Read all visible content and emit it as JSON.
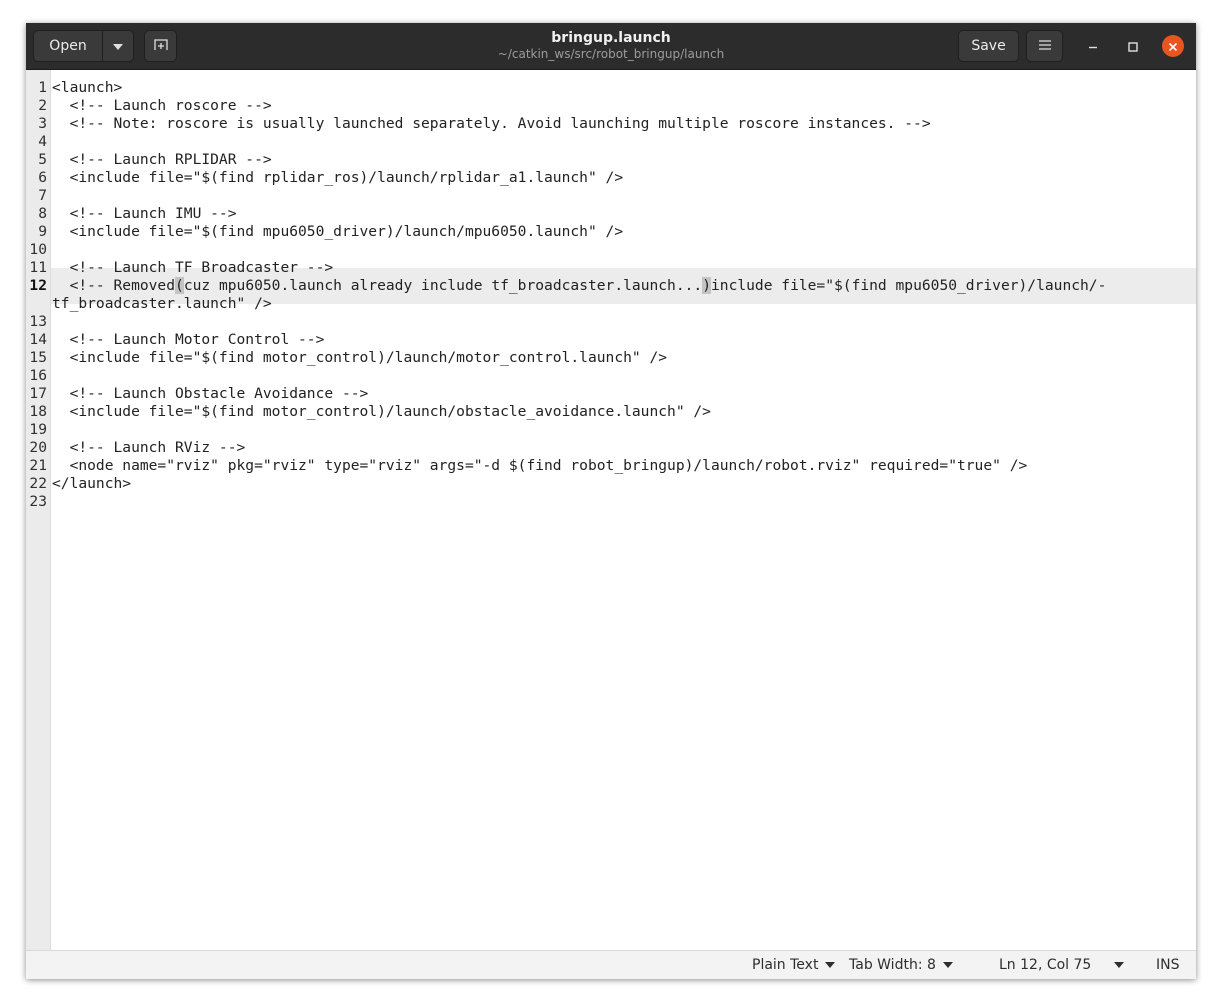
{
  "window": {
    "title": "bringup.launch",
    "subtitle": "~/catkin_ws/src/robot_bringup/launch"
  },
  "header": {
    "open_label": "Open",
    "save_label": "Save",
    "icons": {
      "open_dropdown": "chevron-down-icon",
      "new_tab": "new-tab-icon",
      "menu": "hamburger-menu-icon",
      "minimize": "minimize-icon",
      "maximize": "maximize-icon",
      "close": "close-icon"
    },
    "close_color": "#e95420"
  },
  "editor": {
    "current_line": 12,
    "lines": [
      {
        "n": "1",
        "text": "<launch>"
      },
      {
        "n": "2",
        "text": "  <!-- Launch roscore -->"
      },
      {
        "n": "3",
        "text": "  <!-- Note: roscore is usually launched separately. Avoid launching multiple roscore instances. -->"
      },
      {
        "n": "4",
        "text": ""
      },
      {
        "n": "5",
        "text": "  <!-- Launch RPLIDAR -->"
      },
      {
        "n": "6",
        "text": "  <include file=\"$(find rplidar_ros)/launch/rplidar_a1.launch\" />"
      },
      {
        "n": "7",
        "text": ""
      },
      {
        "n": "8",
        "text": "  <!-- Launch IMU -->"
      },
      {
        "n": "9",
        "text": "  <include file=\"$(find mpu6050_driver)/launch/mpu6050.launch\" />"
      },
      {
        "n": "10",
        "text": ""
      },
      {
        "n": "11",
        "text": "  <!-- Launch TF Broadcaster -->"
      },
      {
        "n": "12",
        "text_before": "  <!-- Removed",
        "bracket_open": "(",
        "text_middle": "cuz mpu6050.launch already include tf_broadcaster.launch...",
        "bracket_close": ")",
        "text_after": "include file=\"$(find mpu6050_driver)/launch/-",
        "wrap": "tf_broadcaster.launch\" />"
      },
      {
        "n": "13",
        "text": ""
      },
      {
        "n": "14",
        "text": "  <!-- Launch Motor Control -->"
      },
      {
        "n": "15",
        "text": "  <include file=\"$(find motor_control)/launch/motor_control.launch\" />"
      },
      {
        "n": "16",
        "text": ""
      },
      {
        "n": "17",
        "text": "  <!-- Launch Obstacle Avoidance -->"
      },
      {
        "n": "18",
        "text": "  <include file=\"$(find motor_control)/launch/obstacle_avoidance.launch\" />"
      },
      {
        "n": "19",
        "text": ""
      },
      {
        "n": "20",
        "text": "  <!-- Launch RViz -->"
      },
      {
        "n": "21",
        "text": "  <node name=\"rviz\" pkg=\"rviz\" type=\"rviz\" args=\"-d $(find robot_bringup)/launch/robot.rviz\" required=\"true\" />"
      },
      {
        "n": "22",
        "text": "</launch>"
      },
      {
        "n": "23",
        "text": ""
      }
    ]
  },
  "statusbar": {
    "language": "Plain Text",
    "tab_width": "Tab Width: 8",
    "position": "Ln 12, Col 75",
    "mode": "INS"
  }
}
